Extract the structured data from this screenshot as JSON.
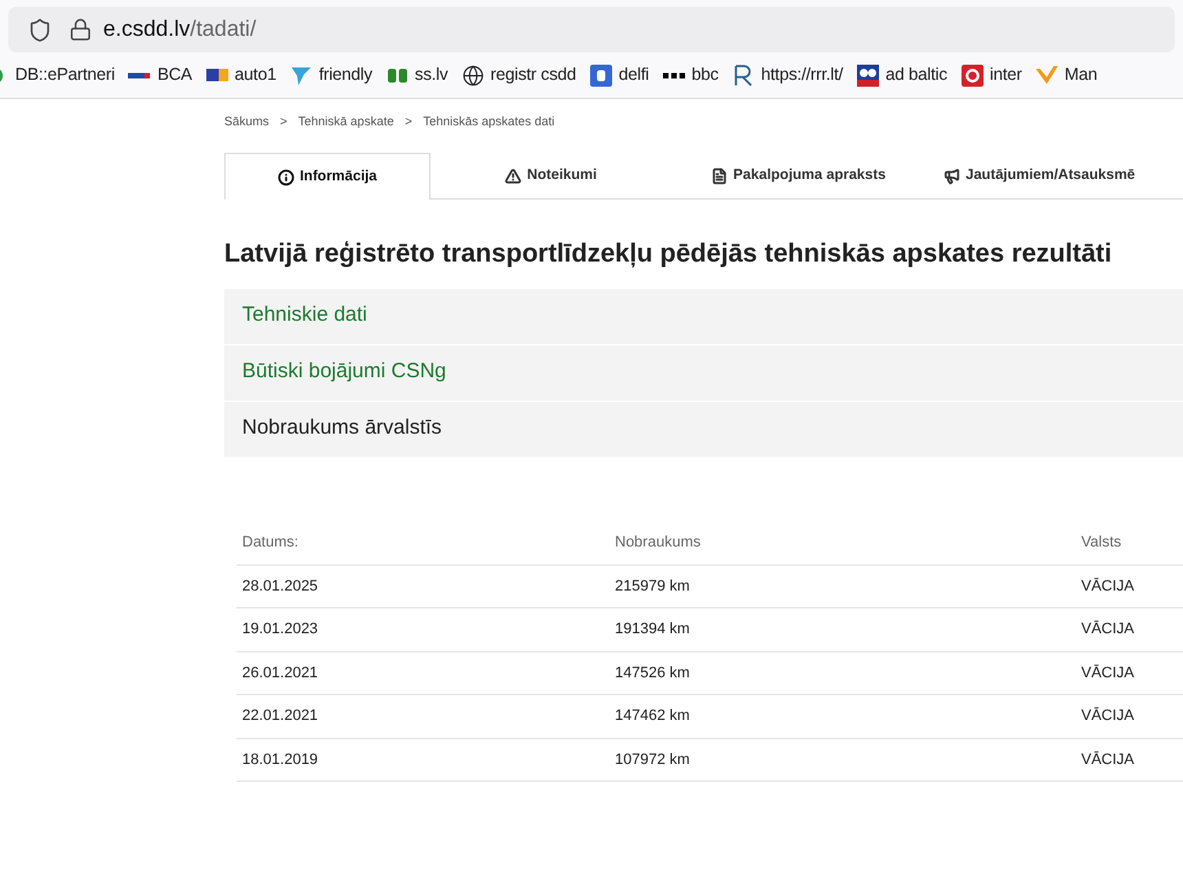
{
  "browser": {
    "url_host": "e.csdd.lv",
    "url_path": "/tadati/"
  },
  "bookmarks": [
    {
      "label": "DB::ePartneri",
      "kind": "circle"
    },
    {
      "label": "BCA",
      "kind": "bar"
    },
    {
      "label": "auto1",
      "kind": "a1"
    },
    {
      "label": "friendly",
      "kind": "bird"
    },
    {
      "label": "ss.lv",
      "kind": "ss"
    },
    {
      "label": "registr csdd",
      "kind": "globe"
    },
    {
      "label": "delfi",
      "kind": "d"
    },
    {
      "label": "bbc",
      "kind": "blocks"
    },
    {
      "label": "https://rrr.lt/",
      "kind": "r"
    },
    {
      "label": "ad baltic",
      "kind": "ad"
    },
    {
      "label": "inter",
      "kind": "inter"
    },
    {
      "label": "Man",
      "kind": "m"
    }
  ],
  "breadcrumb": [
    "Sākums",
    "Tehniskā apskate",
    "Tehniskās apskates dati"
  ],
  "breadcrumb_separator": ">",
  "tabs": [
    {
      "label": "Informācija",
      "kind": "info",
      "selected": true
    },
    {
      "label": "Noteikumi",
      "kind": "warning",
      "selected": false
    },
    {
      "label": "Pakalpojuma apraksts",
      "kind": "document",
      "selected": false
    },
    {
      "label": "Jautājumiem/Atsauksmē",
      "kind": "megaphone",
      "selected": false
    }
  ],
  "heading": "Latvijā reģistrēto transportlīdzekļu pēdējās tehniskās apskates rezultāti",
  "sections": [
    {
      "label": "Tehniskie dati",
      "expanded": false
    },
    {
      "label": "Būtiski bojājumi CSNg",
      "expanded": false
    },
    {
      "label": "Nobraukums ārvalstīs",
      "expanded": true
    }
  ],
  "table": {
    "columns": [
      "Datums:",
      "Nobraukums",
      "Valsts"
    ],
    "rows": [
      [
        "28.01.2025",
        "215979 km",
        "VĀCIJA"
      ],
      [
        "19.01.2023",
        "191394 km",
        "VĀCIJA"
      ],
      [
        "26.01.2021",
        "147526 km",
        "VĀCIJA"
      ],
      [
        "22.01.2021",
        "147462 km",
        "VĀCIJA"
      ],
      [
        "18.01.2019",
        "107972 km",
        "VĀCIJA"
      ]
    ]
  }
}
